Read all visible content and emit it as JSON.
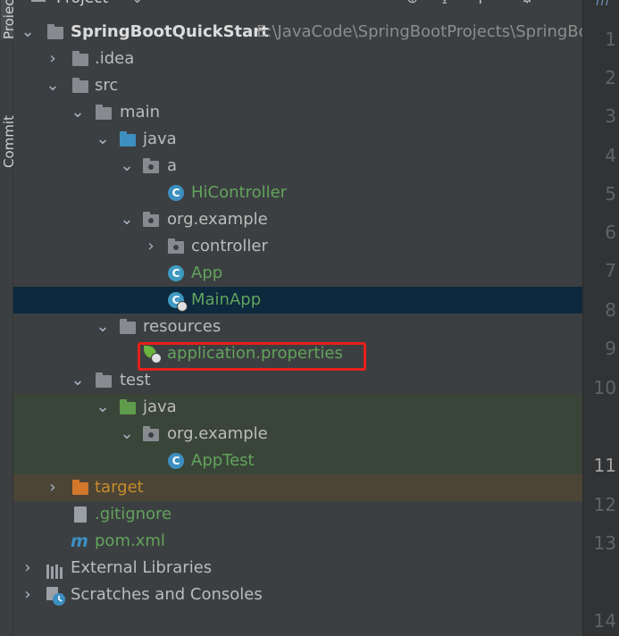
{
  "side_tabs": {
    "project": "Project",
    "commit": "Commit"
  },
  "toolbar": {
    "title": "Project",
    "expand_icon": "⊕",
    "scroll_icon": "⭳",
    "collapse_icon": "⭱",
    "settings_icon": "⚙",
    "hide_icon": "—"
  },
  "tree": [
    {
      "label": "SpringBootQuickStart",
      "path": "E:\\JavaCode\\SpringBootProjects\\SpringBoo"
    },
    {
      "label": ".idea"
    },
    {
      "label": "src"
    },
    {
      "label": "main"
    },
    {
      "label": "java"
    },
    {
      "label": "a"
    },
    {
      "label": "HiController"
    },
    {
      "label": "org.example"
    },
    {
      "label": "controller"
    },
    {
      "label": "App"
    },
    {
      "label": "MainApp"
    },
    {
      "label": "resources"
    },
    {
      "label": "application.properties"
    },
    {
      "label": "test"
    },
    {
      "label": "java"
    },
    {
      "label": "org.example"
    },
    {
      "label": "AppTest"
    },
    {
      "label": "target"
    },
    {
      "label": ".gitignore"
    },
    {
      "label": "pom.xml"
    },
    {
      "label": "External Libraries"
    },
    {
      "label": "Scratches and Consoles"
    }
  ],
  "gutter": {
    "tab_glyph": "m",
    "lines": [
      "1",
      "2",
      "3",
      "4",
      "5",
      "6",
      "7",
      "8",
      "9",
      "10",
      "11",
      "12",
      "13",
      "14"
    ],
    "current_line": "11"
  }
}
